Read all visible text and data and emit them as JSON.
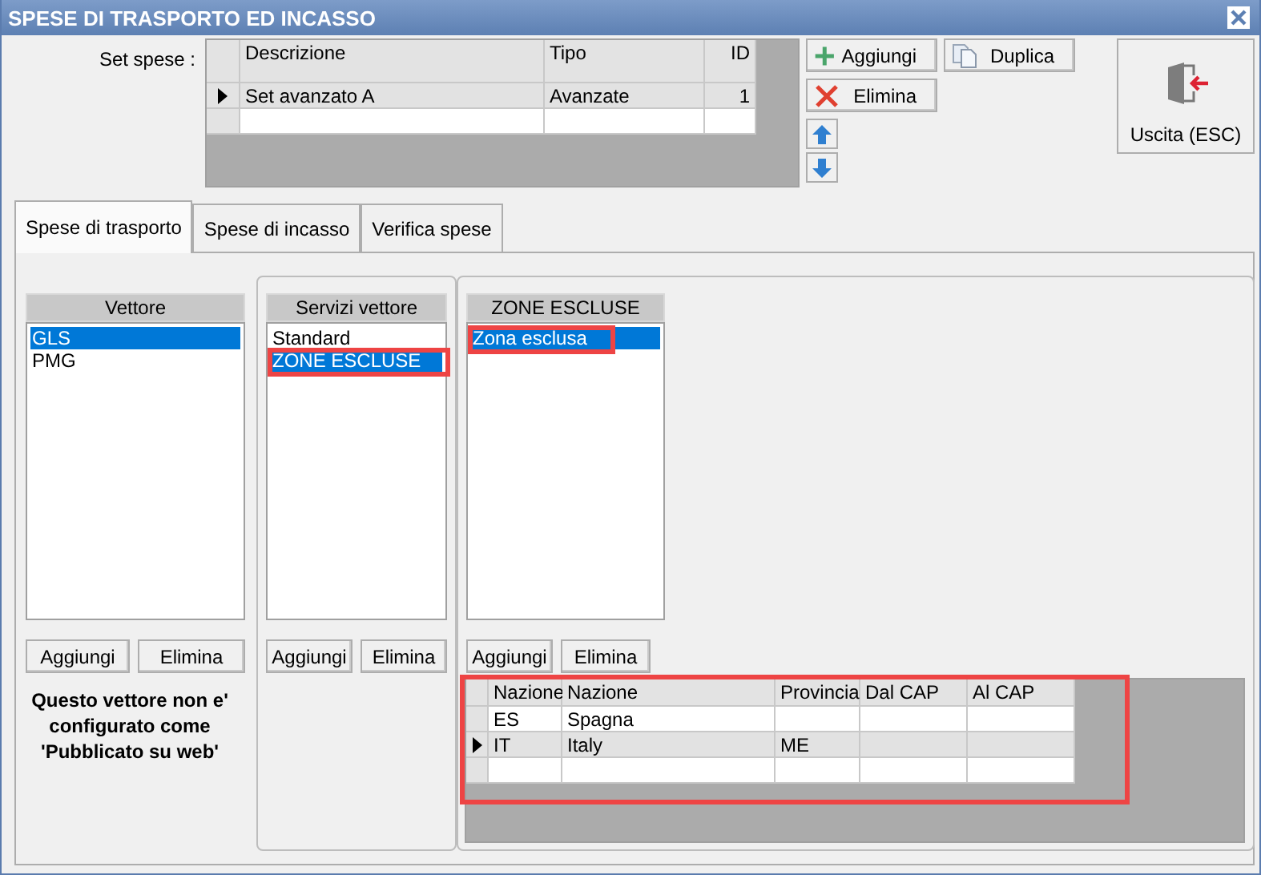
{
  "window": {
    "title": "SPESE DI TRASPORTO ED INCASSO"
  },
  "set_spese": {
    "label": "Set spese :",
    "columns": [
      "Descrizione",
      "Tipo",
      "ID"
    ],
    "rows": [
      {
        "cells": [
          "Set avanzato A",
          "Avanzate",
          "1"
        ],
        "selected": true
      },
      {
        "cells": [
          "",
          "",
          ""
        ],
        "selected": false
      }
    ],
    "buttons": [
      {
        "kind": "add",
        "label": "Aggiungi"
      },
      {
        "kind": "copy",
        "label": "Duplica"
      },
      {
        "kind": "delete",
        "label": "Elimina"
      },
      {
        "kind": "up"
      },
      {
        "kind": "down"
      }
    ],
    "exit_button": {
      "label": "Uscita (ESC)"
    }
  },
  "tabs": [
    {
      "label": "Spese di trasporto",
      "selected": true
    },
    {
      "label": "Spese di incasso",
      "selected": false
    },
    {
      "label": "Verifica spese",
      "selected": false
    }
  ],
  "lists": [
    {
      "header": "Vettore",
      "items": [
        {
          "label": "GLS",
          "selected": true,
          "highlighted": false
        },
        {
          "label": "PMG",
          "selected": false,
          "highlighted": false
        }
      ],
      "buttons": [
        "Aggiungi",
        "Elimina"
      ],
      "note": "Questo vettore non e' configurato come 'Pubblicato su web'"
    },
    {
      "header": "Servizi vettore",
      "items": [
        {
          "label": "Standard",
          "selected": false,
          "highlighted": false
        },
        {
          "label": "ZONE ESCLUSE",
          "selected": true,
          "highlighted": true
        }
      ],
      "buttons": [
        "Aggiungi",
        "Elimina"
      ]
    },
    {
      "header": "ZONE ESCLUSE",
      "items": [
        {
          "label": "Zona esclusa",
          "selected": true,
          "highlighted": true
        }
      ],
      "buttons": [
        "Aggiungi",
        "Elimina"
      ]
    }
  ],
  "zone_grid": {
    "highlighted": true,
    "columns": [
      "Nazione",
      "Nazione",
      "Provincia",
      "Dal CAP",
      "Al CAP"
    ],
    "rows": [
      {
        "cells": [
          "ES",
          "Spagna",
          "",
          "",
          ""
        ],
        "selected": false
      },
      {
        "cells": [
          "IT",
          "Italy",
          "ME",
          "",
          ""
        ],
        "selected": true
      },
      {
        "cells": [
          "",
          "",
          "",
          "",
          ""
        ],
        "selected": false
      }
    ]
  }
}
